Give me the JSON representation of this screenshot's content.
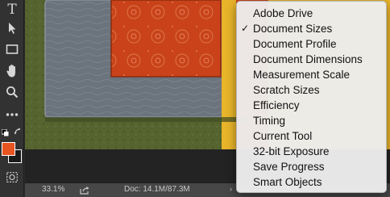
{
  "toolbar": {
    "tools": [
      {
        "name": "type-tool",
        "icon": "T"
      },
      {
        "name": "path-selection-tool",
        "icon": "arrow-cursor-icon"
      },
      {
        "name": "rectangle-tool",
        "icon": "rectangle-icon"
      },
      {
        "name": "hand-tool",
        "icon": "hand-icon"
      },
      {
        "name": "zoom-tool",
        "icon": "magnifier-icon"
      },
      {
        "name": "more-tools",
        "icon": "ellipsis-icon"
      }
    ],
    "foreground_color": "#e8541f",
    "background_color": "#1b1b1b"
  },
  "canvas": {
    "colors": {
      "green": "#56652f",
      "slate": "#6b737c",
      "orange": "#c9421a",
      "yellow": "#e8b42a"
    }
  },
  "status_bar": {
    "zoom": "33.1%",
    "doc_info": "Doc: 14.1M/87.3M",
    "arrow": "›"
  },
  "menu": {
    "checkmark": "✓",
    "items": [
      {
        "label": "Adobe Drive",
        "checked": false
      },
      {
        "label": "Document Sizes",
        "checked": true
      },
      {
        "label": "Document Profile",
        "checked": false
      },
      {
        "label": "Document Dimensions",
        "checked": false
      },
      {
        "label": "Measurement Scale",
        "checked": false
      },
      {
        "label": "Scratch Sizes",
        "checked": false
      },
      {
        "label": "Efficiency",
        "checked": false
      },
      {
        "label": "Timing",
        "checked": false
      },
      {
        "label": "Current Tool",
        "checked": false
      },
      {
        "label": "32-bit Exposure",
        "checked": false
      },
      {
        "label": "Save Progress",
        "checked": false
      },
      {
        "label": "Smart Objects",
        "checked": false
      }
    ]
  }
}
